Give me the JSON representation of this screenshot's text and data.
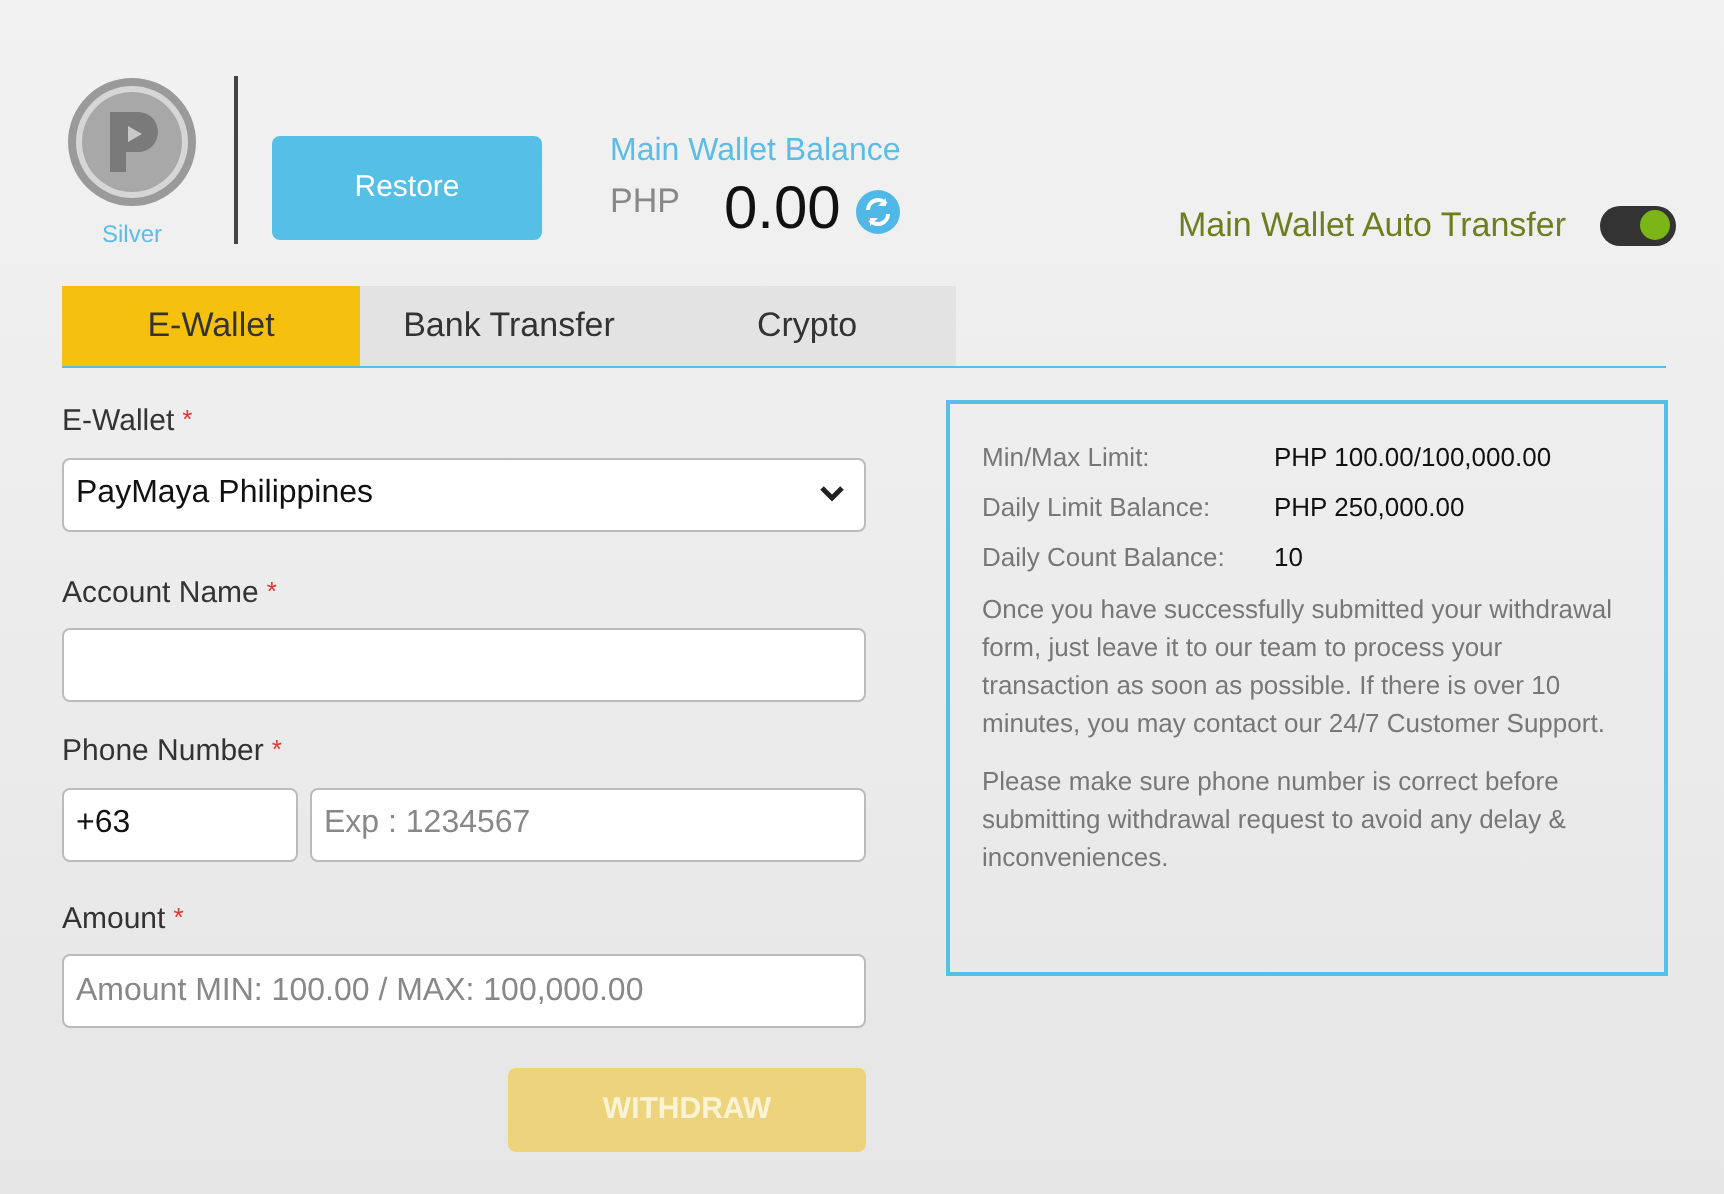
{
  "profile": {
    "tier": "Silver"
  },
  "restore_button": "Restore",
  "balance": {
    "title": "Main Wallet Balance",
    "currency": "PHP",
    "amount": "0.00"
  },
  "auto_transfer": {
    "label": "Main Wallet Auto Transfer",
    "on": true
  },
  "tabs": [
    {
      "label": "E-Wallet",
      "selected": true
    },
    {
      "label": "Bank Transfer",
      "selected": false
    },
    {
      "label": "Crypto",
      "selected": false
    }
  ],
  "form": {
    "ewallet": {
      "label": "E-Wallet",
      "required": "*",
      "value": "PayMaya Philippines"
    },
    "account_name": {
      "label": "Account Name",
      "required": "*"
    },
    "phone": {
      "label": "Phone Number",
      "required": "*",
      "prefix": "+63",
      "placeholder": "Exp : 1234567"
    },
    "amount": {
      "label": "Amount",
      "required": "*",
      "placeholder": "Amount MIN: 100.00 / MAX: 100,000.00"
    },
    "submit": {
      "label": "WITHDRAW",
      "disabled": true
    }
  },
  "info": {
    "limits": [
      {
        "label": "Min/Max Limit:",
        "value": "PHP 100.00/100,000.00"
      },
      {
        "label": "Daily Limit Balance:",
        "value": "PHP 250,000.00"
      },
      {
        "label": "Daily Count Balance:",
        "value": "10"
      }
    ],
    "notes": [
      "Once you have successfully submitted your withdrawal form, just leave it to our team to process your transaction as soon as possible. If there is over 10 minutes, you may contact our 24/7 Customer Support.",
      "Please make sure phone number is correct before submitting withdrawal request to avoid any delay & inconveniences."
    ]
  }
}
